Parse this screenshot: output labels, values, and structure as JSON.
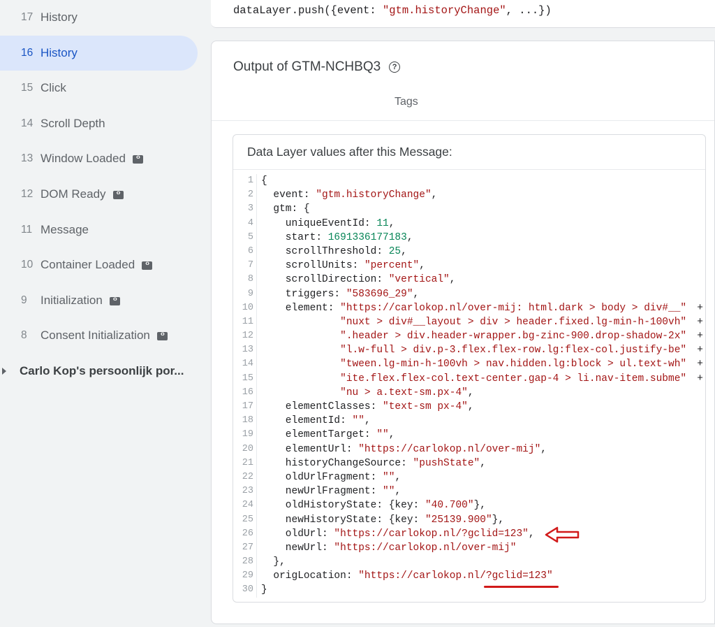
{
  "sidebar": {
    "events": [
      {
        "num": "17",
        "label": "History",
        "active": false,
        "badge": false
      },
      {
        "num": "16",
        "label": "History",
        "active": true,
        "badge": false
      },
      {
        "num": "15",
        "label": "Click",
        "active": false,
        "badge": false
      },
      {
        "num": "14",
        "label": "Scroll Depth",
        "active": false,
        "badge": false
      },
      {
        "num": "13",
        "label": "Window Loaded",
        "active": false,
        "badge": true
      },
      {
        "num": "12",
        "label": "DOM Ready",
        "active": false,
        "badge": true
      },
      {
        "num": "11",
        "label": "Message",
        "active": false,
        "badge": false
      },
      {
        "num": "10",
        "label": "Container Loaded",
        "active": false,
        "badge": true
      },
      {
        "num": "9",
        "label": "Initialization",
        "active": false,
        "badge": true
      },
      {
        "num": "8",
        "label": "Consent Initialization",
        "active": false,
        "badge": true
      }
    ],
    "container_label": "Carlo Kop's persoonlijk por..."
  },
  "top_card": {
    "code_prefix": "dataLayer.push({event: ",
    "code_string": "\"gtm.historyChange\"",
    "code_suffix": ", ...})"
  },
  "output": {
    "title": "Output of GTM-NCHBQ3",
    "tab_tags": "Tags",
    "datalayer_header": "Data Layer values after this Message:"
  },
  "code_lines": [
    [
      [
        "k",
        "{"
      ]
    ],
    [
      [
        "k",
        "  event: "
      ],
      [
        "s",
        "\"gtm.historyChange\""
      ],
      [
        "k",
        ","
      ]
    ],
    [
      [
        "k",
        "  gtm: {"
      ]
    ],
    [
      [
        "k",
        "    uniqueEventId: "
      ],
      [
        "n",
        "11"
      ],
      [
        "k",
        ","
      ]
    ],
    [
      [
        "k",
        "    start: "
      ],
      [
        "n",
        "1691336177183"
      ],
      [
        "k",
        ","
      ]
    ],
    [
      [
        "k",
        "    scrollThreshold: "
      ],
      [
        "n",
        "25"
      ],
      [
        "k",
        ","
      ]
    ],
    [
      [
        "k",
        "    scrollUnits: "
      ],
      [
        "s",
        "\"percent\""
      ],
      [
        "k",
        ","
      ]
    ],
    [
      [
        "k",
        "    scrollDirection: "
      ],
      [
        "s",
        "\"vertical\""
      ],
      [
        "k",
        ","
      ]
    ],
    [
      [
        "k",
        "    triggers: "
      ],
      [
        "s",
        "\"583696_29\""
      ],
      [
        "k",
        ","
      ]
    ],
    [
      [
        "k",
        "    element: "
      ],
      [
        "s",
        "\"https://carlokop.nl/over-mij: html.dark > body > div#__\""
      ],
      [
        "plus",
        " +"
      ]
    ],
    [
      [
        "k",
        "             "
      ],
      [
        "s",
        "\"nuxt > div#__layout > div > header.fixed.lg-min-h-100vh\""
      ],
      [
        "plus",
        " +"
      ]
    ],
    [
      [
        "k",
        "             "
      ],
      [
        "s",
        "\".header > div.header-wrapper.bg-zinc-900.drop-shadow-2x\""
      ],
      [
        "plus",
        " +"
      ]
    ],
    [
      [
        "k",
        "             "
      ],
      [
        "s",
        "\"l.w-full > div.p-3.flex.flex-row.lg:flex-col.justify-be\""
      ],
      [
        "plus",
        " +"
      ]
    ],
    [
      [
        "k",
        "             "
      ],
      [
        "s",
        "\"tween.lg-min-h-100vh > nav.hidden.lg:block > ul.text-wh\""
      ],
      [
        "plus",
        " +"
      ]
    ],
    [
      [
        "k",
        "             "
      ],
      [
        "s",
        "\"ite.flex.flex-col.text-center.gap-4 > li.nav-item.subme\""
      ],
      [
        "plus",
        " +"
      ]
    ],
    [
      [
        "k",
        "             "
      ],
      [
        "s",
        "\"nu > a.text-sm.px-4\""
      ],
      [
        "k",
        ","
      ]
    ],
    [
      [
        "k",
        "    elementClasses: "
      ],
      [
        "s",
        "\"text-sm px-4\""
      ],
      [
        "k",
        ","
      ]
    ],
    [
      [
        "k",
        "    elementId: "
      ],
      [
        "s",
        "\"\""
      ],
      [
        "k",
        ","
      ]
    ],
    [
      [
        "k",
        "    elementTarget: "
      ],
      [
        "s",
        "\"\""
      ],
      [
        "k",
        ","
      ]
    ],
    [
      [
        "k",
        "    elementUrl: "
      ],
      [
        "s",
        "\"https://carlokop.nl/over-mij\""
      ],
      [
        "k",
        ","
      ]
    ],
    [
      [
        "k",
        "    historyChangeSource: "
      ],
      [
        "s",
        "\"pushState\""
      ],
      [
        "k",
        ","
      ]
    ],
    [
      [
        "k",
        "    oldUrlFragment: "
      ],
      [
        "s",
        "\"\""
      ],
      [
        "k",
        ","
      ]
    ],
    [
      [
        "k",
        "    newUrlFragment: "
      ],
      [
        "s",
        "\"\""
      ],
      [
        "k",
        ","
      ]
    ],
    [
      [
        "k",
        "    oldHistoryState: {key: "
      ],
      [
        "s",
        "\"40.700\""
      ],
      [
        "k",
        "},"
      ]
    ],
    [
      [
        "k",
        "    newHistoryState: {key: "
      ],
      [
        "s",
        "\"25139.900\""
      ],
      [
        "k",
        "},"
      ]
    ],
    [
      [
        "k",
        "    oldUrl: "
      ],
      [
        "s",
        "\"https://carlokop.nl/?gclid=123\""
      ],
      [
        "k",
        ","
      ]
    ],
    [
      [
        "k",
        "    newUrl: "
      ],
      [
        "s",
        "\"https://carlokop.nl/over-mij\""
      ]
    ],
    [
      [
        "k",
        "  },"
      ]
    ],
    [
      [
        "k",
        "  origLocation: "
      ],
      [
        "s",
        "\"https://carlokop.nl/?gclid=123\""
      ]
    ],
    [
      [
        "k",
        "}"
      ]
    ]
  ],
  "colors": {
    "accent": "#1a55c4",
    "active_bg": "#dbe6fb",
    "string": "#a31515",
    "number": "#098658",
    "annotation_red": "#d11a1a"
  }
}
